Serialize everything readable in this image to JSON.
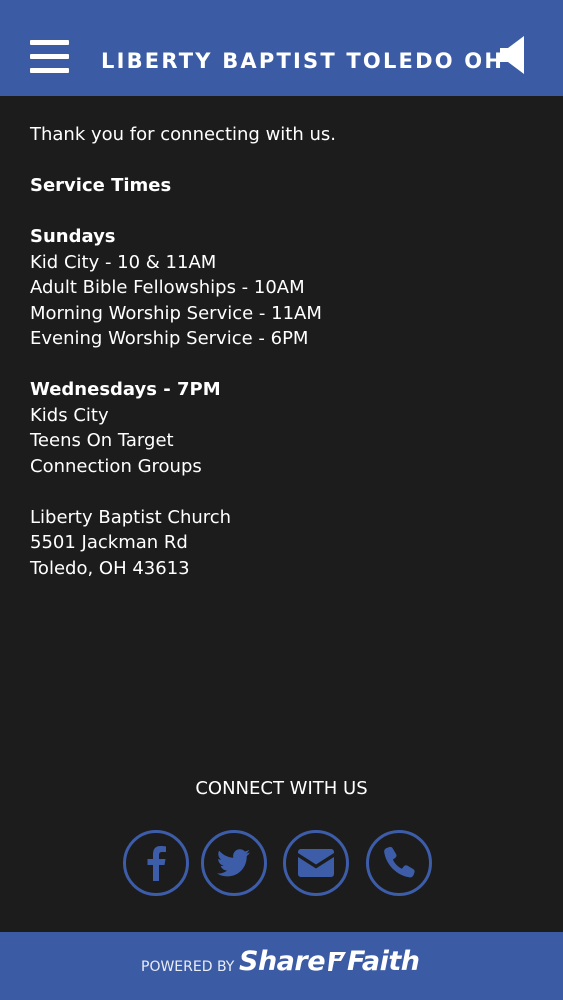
{
  "header": {
    "title": "LIBERTY BAPTIST TOLEDO OH",
    "menu_icon": "hamburger-menu-icon",
    "sound_icon": "speaker-icon"
  },
  "content": {
    "intro": "Thank you for connecting with us.",
    "service_times_heading": "Service Times",
    "sundays": {
      "heading": "Sundays",
      "items": [
        "Kid City - 10 & 11AM",
        "Adult Bible Fellowships - 10AM",
        "Morning Worship Service - 11AM",
        "Evening Worship Service - 6PM"
      ]
    },
    "wednesdays": {
      "heading": "Wednesdays - 7PM",
      "items": [
        "Kids City",
        "Teens On Target",
        "Connection Groups"
      ]
    },
    "address": {
      "name": "Liberty Baptist Church",
      "street": "5501 Jackman Rd",
      "city": "Toledo, OH 43613"
    }
  },
  "connect": {
    "title": "CONNECT WITH US",
    "icons": [
      "facebook-icon",
      "twitter-icon",
      "email-icon",
      "phone-icon"
    ]
  },
  "footer": {
    "powered_by": "POWERED BY",
    "brand_left": "Share",
    "brand_right": "Faith"
  },
  "colors": {
    "header_bg": "#3b5ba5",
    "page_bg": "#1c1c1d",
    "social_blue": "#3d5da9",
    "text": "#ffffff"
  }
}
